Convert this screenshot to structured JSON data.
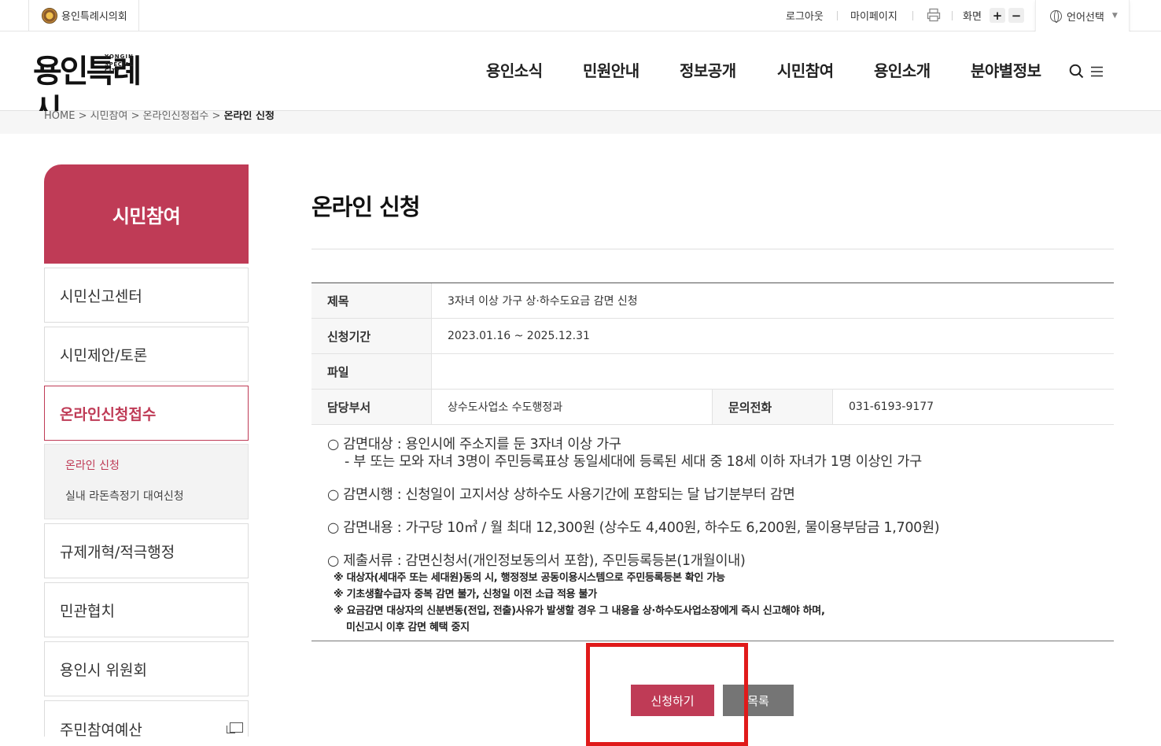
{
  "topbar": {
    "council_label": "용인특례시의회",
    "logout": "로그아웃",
    "mypage": "마이페이지",
    "screen_label": "화면",
    "zoom_in": "+",
    "zoom_out": "−",
    "language": "언어선택"
  },
  "header": {
    "logo_ko": "용인특례시",
    "logo_en_1": "YONGIN",
    "logo_en_2": "SPECIAL CITY",
    "nav": [
      "용인소식",
      "민원안내",
      "정보공개",
      "시민참여",
      "용인소개",
      "분야별정보"
    ]
  },
  "breadcrumb": {
    "items": [
      "HOME",
      "시민참여",
      "온라인신청접수"
    ],
    "current": "온라인 신청",
    "separator": ">"
  },
  "sidebar": {
    "title": "시민참여",
    "items": [
      "시민신고센터",
      "시민제안/토론",
      "온라인신청접수",
      "규제개혁/적극행정",
      "민관협치",
      "용인시 위원회",
      "주민참여예산"
    ],
    "sub_items": [
      "온라인 신청",
      "실내 라돈측정기 대여신청"
    ]
  },
  "main": {
    "page_title": "온라인 신청",
    "table": {
      "title_label": "제목",
      "title_value": "3자녀 이상 가구 상·하수도요금 감면 신청",
      "period_label": "신청기간",
      "period_value": "2023.01.16 ~ 2025.12.31",
      "file_label": "파일",
      "file_value": "",
      "dept_label": "담당부서",
      "dept_value": "상수도사업소 수도행정과",
      "phone_label": "문의전화",
      "phone_value": "031-6193-9177"
    },
    "description": [
      "○ 감면대상 : 용인시에 주소지를 둔 3자녀 이상 가구",
      "- 부 또는 모와 자녀 3명이 주민등록표상 동일세대에 등록된 세대 중 18세 이하 자녀가 1명 이상인 가구",
      "○ 감면시행 : 신청일이 고지서상 상하수도 사용기간에 포함되는 달 납기분부터 감면",
      "○ 감면내용 : 가구당 10㎥ / 월 최대 12,300원 (상수도 4,400원, 하수도 6,200원, 물이용부담금 1,700원)",
      "○ 제출서류 : 감면신청서(개인정보동의서 포함), 주민등록등본(1개월이내)"
    ],
    "notes": [
      "※ 대상자(세대주 또는 세대원)동의 시, 행정정보 공동이용시스템으로 주민등록등본 확인 가능",
      "※ 기초생활수급자 중복 감면 불가, 신청일 이전 소급 적용 불가",
      "※ 요금감면 대상자의 신분변동(전입, 전출)사유가 발생할 경우 그 내용을 상·하수도사업소장에게 즉시 신고해야 하며,",
      "미신고시 이후 감면 혜택 중지"
    ],
    "apply_button": "신청하기",
    "list_button": "목록"
  },
  "colors": {
    "accent": "#bf3b56",
    "list_button": "#757575",
    "highlight_box": "#e01a1a"
  }
}
